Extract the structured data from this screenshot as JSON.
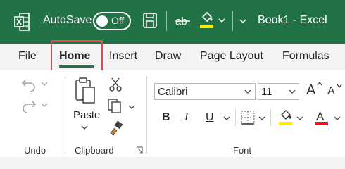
{
  "titlebar": {
    "autosave_label": "AutoSave",
    "toggle_state": "Off",
    "document_title": "Book1  -  Excel"
  },
  "tabs": [
    {
      "label": "File"
    },
    {
      "label": "Home",
      "active": true
    },
    {
      "label": "Insert"
    },
    {
      "label": "Draw"
    },
    {
      "label": "Page Layout"
    },
    {
      "label": "Formulas"
    }
  ],
  "ribbon": {
    "undo_group_label": "Undo",
    "clipboard_group_label": "Clipboard",
    "font_group_label": "Font",
    "paste_label": "Paste",
    "font_name": "Calibri",
    "font_size": "11",
    "bold_label": "B",
    "italic_label": "I",
    "underline_label": "U",
    "font_color_label": "A"
  },
  "colors": {
    "titlebar_bg": "#217346",
    "highlight_color": "#ffeb00",
    "font_color": "#e81123",
    "tab_focus_border": "#e8484d"
  }
}
